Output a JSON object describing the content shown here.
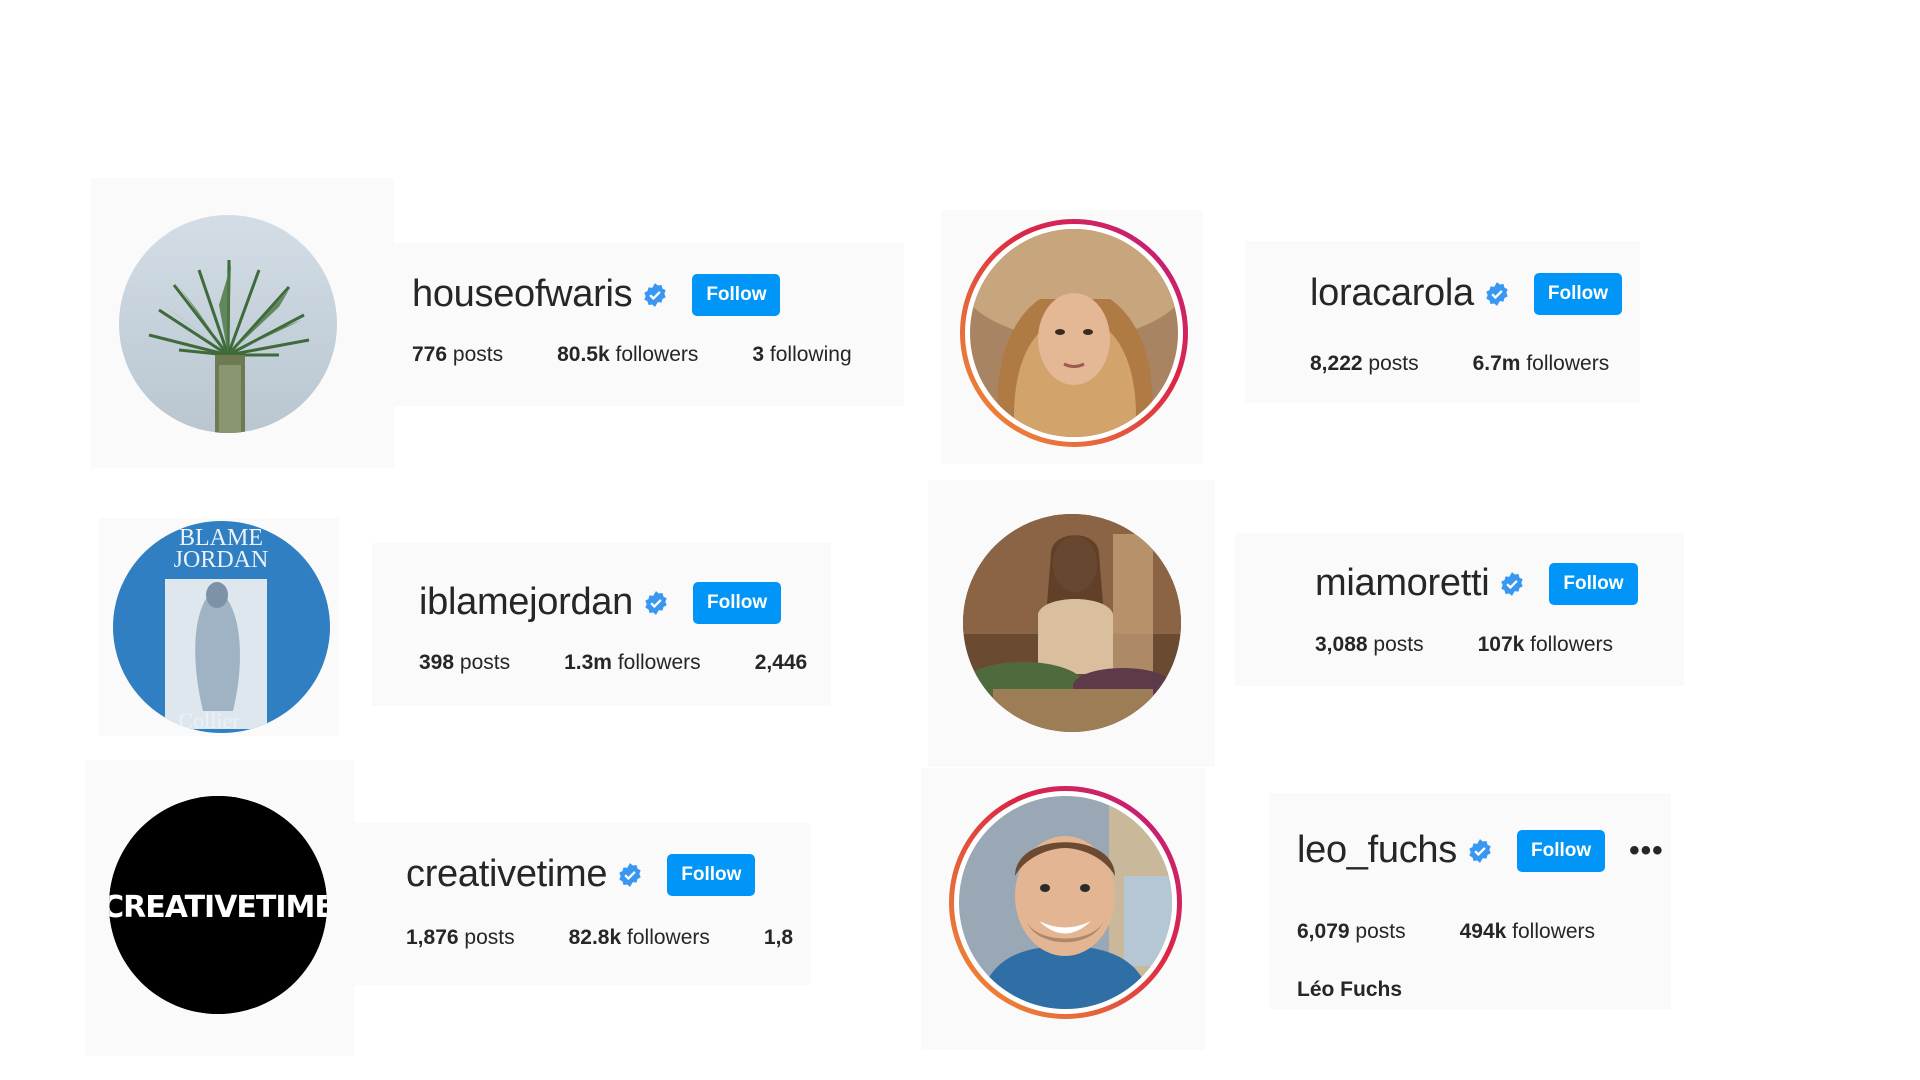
{
  "follow_label": "Follow",
  "accent": "#0095f6",
  "profiles": [
    {
      "username": "houseofwaris",
      "verified": true,
      "posts": {
        "count": "776",
        "label": "posts"
      },
      "followers": {
        "count": "80.5k",
        "label": "followers"
      },
      "following": {
        "count": "3",
        "label": "following"
      },
      "avatar": "palm-tree-photo"
    },
    {
      "username": "loracarola",
      "verified": true,
      "posts": {
        "count": "8,222",
        "label": "posts"
      },
      "followers": {
        "count": "6.7m",
        "label": "followers"
      },
      "avatar": "woman-straw-hat-photo",
      "story_ring": true
    },
    {
      "username": "iblamejordan",
      "verified": true,
      "posts": {
        "count": "398",
        "label": "posts"
      },
      "followers": {
        "count": "1.3m",
        "label": "followers"
      },
      "following": {
        "count": "2,446"
      },
      "avatar": "blame-jordan-book-cover",
      "avatar_text": {
        "top1": "BLAME",
        "top2": "JORDAN",
        "bottom": "Collier"
      }
    },
    {
      "username": "miamoretti",
      "verified": true,
      "posts": {
        "count": "3,088",
        "label": "posts"
      },
      "followers": {
        "count": "107k",
        "label": "followers"
      },
      "avatar": "woman-with-plants-photo"
    },
    {
      "username": "creativetime",
      "verified": true,
      "posts": {
        "count": "1,876",
        "label": "posts"
      },
      "followers": {
        "count": "82.8k",
        "label": "followers"
      },
      "following": {
        "count": "1,8"
      },
      "avatar": "creativetime-logo",
      "avatar_text": "CREATIVETIME"
    },
    {
      "username": "leo_fuchs",
      "verified": true,
      "posts": {
        "count": "6,079",
        "label": "posts"
      },
      "followers": {
        "count": "494k",
        "label": "followers"
      },
      "full_name": "Léo Fuchs",
      "more_label": "•••",
      "avatar": "smiling-man-photo",
      "story_ring": true
    }
  ]
}
